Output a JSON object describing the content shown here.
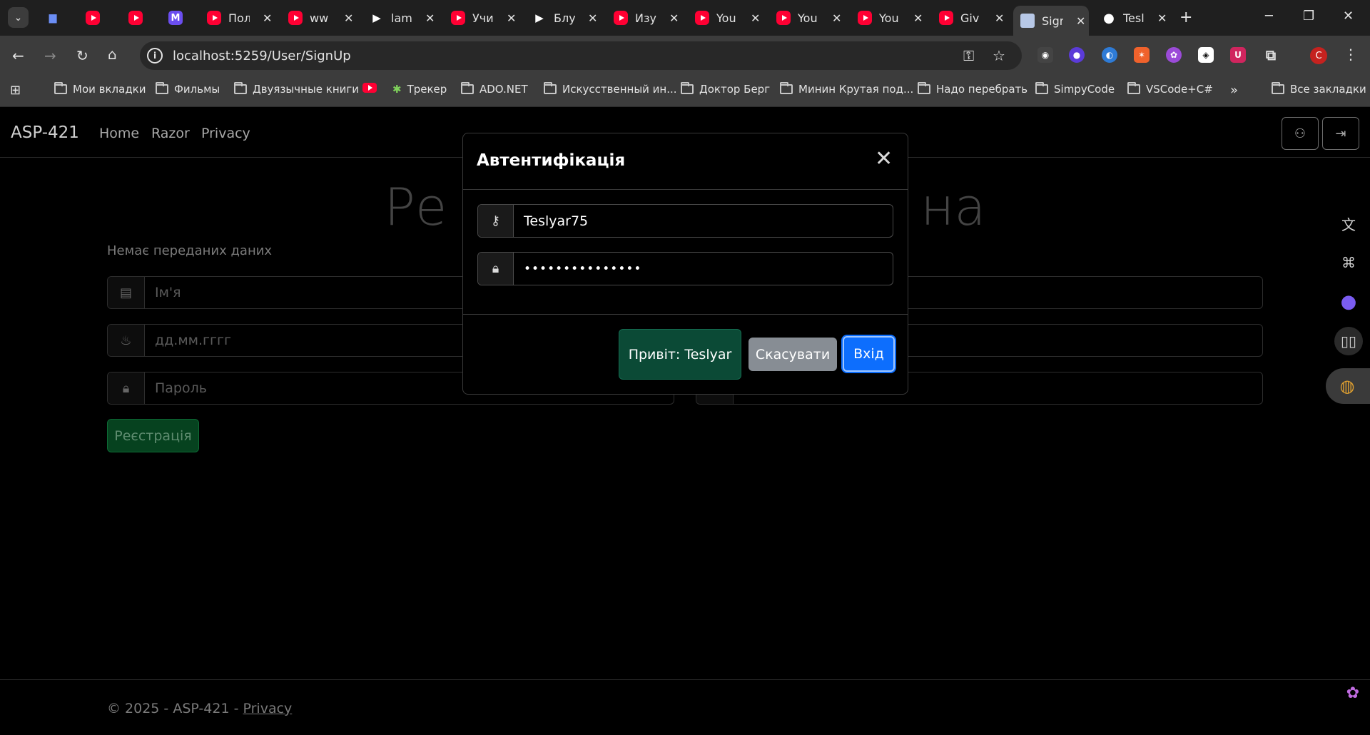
{
  "tabs": [
    {
      "title": "",
      "icon": "bars-icon"
    },
    {
      "title": "",
      "icon": "youtube-icon"
    },
    {
      "title": "",
      "icon": "youtube-icon"
    },
    {
      "title": "",
      "icon": "m-logo-icon"
    },
    {
      "title": "Пол",
      "icon": "youtube-icon"
    },
    {
      "title": "ww",
      "icon": "youtube-icon"
    },
    {
      "title": "lam",
      "icon": "play-icon"
    },
    {
      "title": "Учи",
      "icon": "youtube-icon"
    },
    {
      "title": "Блу",
      "icon": "play-icon"
    },
    {
      "title": "Изу",
      "icon": "youtube-icon"
    },
    {
      "title": "You",
      "icon": "youtube-icon"
    },
    {
      "title": "You",
      "icon": "youtube-icon"
    },
    {
      "title": "You",
      "icon": "youtube-icon"
    },
    {
      "title": "Giv",
      "icon": "youtube-icon"
    },
    {
      "title": "Sigr",
      "icon": "document-icon"
    },
    {
      "title": "Tesl",
      "icon": "github-icon"
    }
  ],
  "address_bar": {
    "url": "localhost:5259/User/SignUp"
  },
  "profile_initial": "C",
  "bookmarks": {
    "items": [
      "Мои вкладки",
      "Фильмы",
      "Двуязычные книги",
      "",
      "Трекер",
      "ADO.NET",
      "Искусственный ин...",
      "Доктор Берг",
      "Минин Крутая под...",
      "Надо перебрать",
      "SimpyCode",
      "VSCode+C#"
    ],
    "more": "»",
    "all": "Все закладки"
  },
  "site": {
    "brand": "ASP-421",
    "nav": [
      "Home",
      "Razor",
      "Privacy"
    ]
  },
  "signup": {
    "title_left": "Ре",
    "title_right": "на",
    "no_data": "Немає переданих даних",
    "name_placeholder": "Ім'я",
    "date_placeholder": "дд.мм.гггг",
    "password_placeholder": "Пароль",
    "register_label": "Реєстрація"
  },
  "footer": {
    "copyright": "© 2025 - ASP-421 - ",
    "privacy": "Privacy"
  },
  "modal": {
    "title": "Автентифікація",
    "login_value": "Teslyar75",
    "password_value": "•••••••••••••••",
    "greet_label": "Привіт: Teslyar",
    "cancel_label": "Скасувати",
    "login_label": "Вхід"
  }
}
